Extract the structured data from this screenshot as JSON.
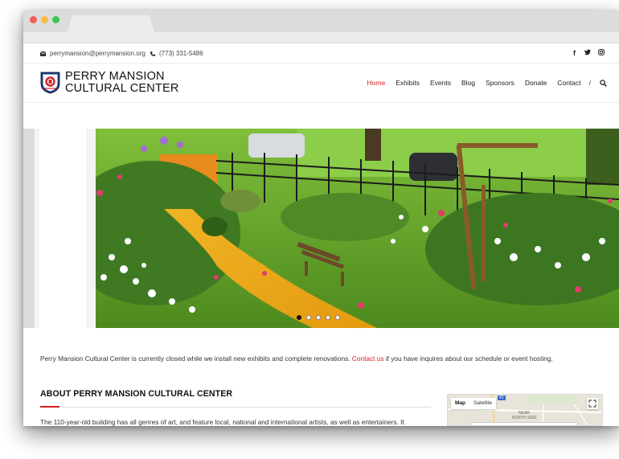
{
  "site": {
    "email": "perrymansion@perrymansion.org",
    "phone": "(773) 331-5486",
    "title_line1": "PERRY MANSION",
    "title_line2": "CULTURAL CENTER",
    "social_icons": [
      "facebook-icon",
      "twitter-icon",
      "instagram-icon"
    ]
  },
  "nav": {
    "items": [
      "Home",
      "Exhibits",
      "Events",
      "Blog",
      "Sponsors",
      "Donate",
      "Contact"
    ],
    "active": "Home",
    "separator": "/"
  },
  "slider": {
    "dot_count": 5,
    "active_dot": 1
  },
  "notice": {
    "text_before": "Perry Mansion Cultural Center is currently closed while we install new exhibits and complete renovations.",
    "link": "Contact us",
    "text_after": "if you have inquires about our schedule or event hosting."
  },
  "about": {
    "title": "ABOUT PERRY MANSION CULTURAL CENTER",
    "text": "The 110-year-old building has all genres of art, and feature local, national and international artists, as well as entertainers. It"
  },
  "map": {
    "tab_map": "Map",
    "tab_satellite": "Satellite",
    "label_shield": "41",
    "label_near": "NEAR",
    "label_north_side": "NORTH SIDE"
  },
  "colors": {
    "accent": "#d11f1f",
    "text": "#333333"
  }
}
